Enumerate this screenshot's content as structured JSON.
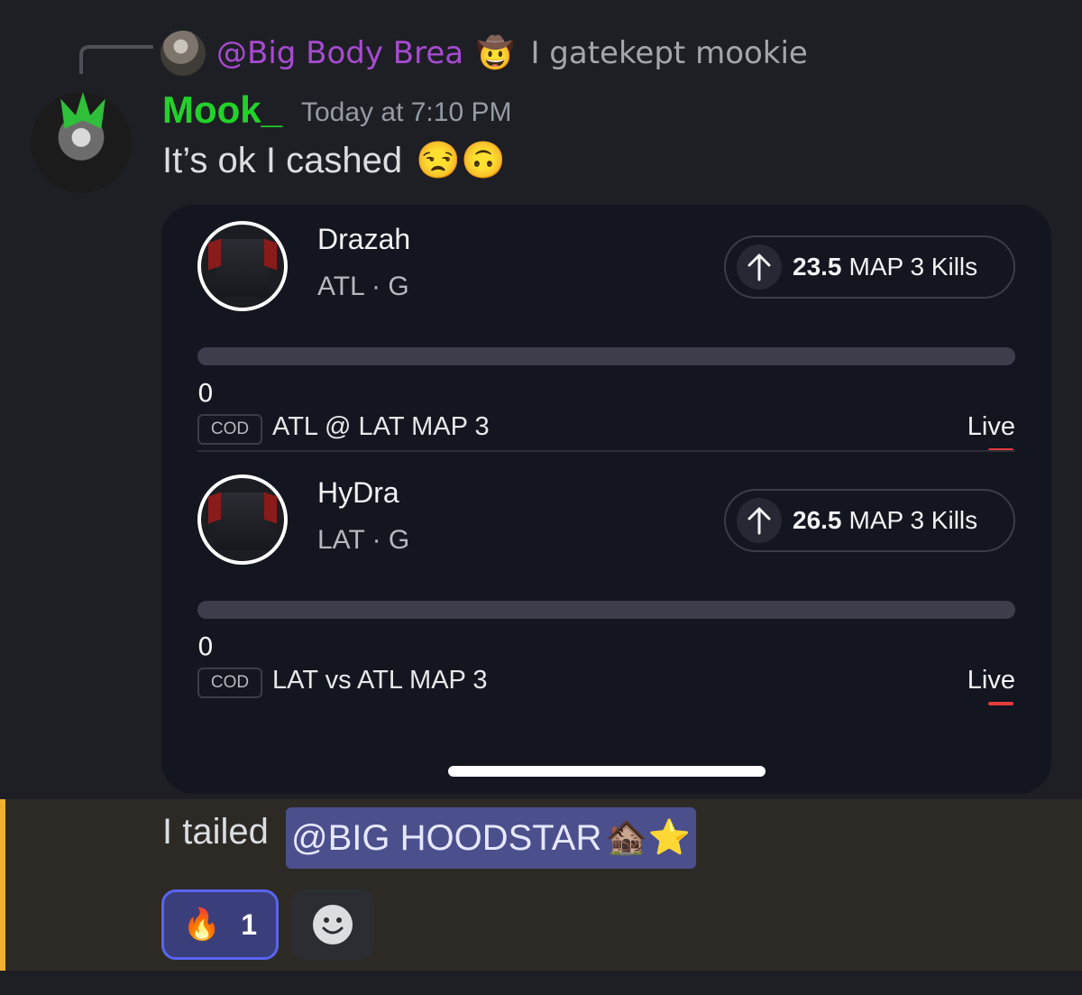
{
  "reply": {
    "author": "@Big Body Brea",
    "author_emoji": "🤠",
    "text": "I gatekept mookie",
    "author_color": "#a74bd1"
  },
  "message": {
    "username": "Mook_",
    "username_color": "#22d22a",
    "timestamp": "Today at 7:10 PM",
    "text": "It’s ok I cashed",
    "emojis": "😒🙃"
  },
  "picks": [
    {
      "player": "Drazah",
      "team_pos": "ATL · G",
      "line": "23.5",
      "stat": "MAP 3 Kills",
      "direction": "up-arrow-icon",
      "progress": 0,
      "current_value": "0",
      "league": "COD",
      "match": "ATL  @ LAT MAP 3",
      "status": "Live"
    },
    {
      "player": "HyDra",
      "team_pos": "LAT · G",
      "line": "26.5",
      "stat": "MAP 3 Kills",
      "direction": "up-arrow-icon",
      "progress": 0,
      "current_value": "0",
      "league": "COD",
      "match": "LAT vs ATL MAP 3",
      "status": "Live"
    }
  ],
  "next_message": {
    "text": "I tailed",
    "mention": "@BIG HOODSTAR",
    "mention_emojis": "🏚️⭐",
    "highlight_color": "#f0b132"
  },
  "reactions": [
    {
      "emoji": "🔥",
      "count": "1"
    }
  ],
  "icons": {
    "add_reaction": "smiley-face-icon"
  }
}
